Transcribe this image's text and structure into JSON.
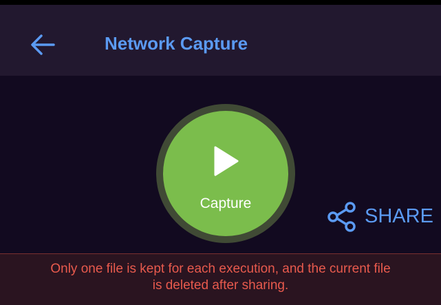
{
  "app_bar": {
    "back_icon": "arrow-left-icon",
    "title": "Network Capture"
  },
  "capture": {
    "icon": "play-icon",
    "label": "Capture"
  },
  "share": {
    "icon": "share-icon",
    "label": "SHARE"
  },
  "notice": {
    "line1": "Only one file is kept for each execution, and the current file",
    "line2": "is deleted after sharing."
  },
  "colors": {
    "app_bar_background": "#22182f",
    "page_background": "#120a20",
    "accent_blue": "#5b9af2",
    "capture_green": "#7bbd4c",
    "warning_red": "#e85a4d"
  }
}
